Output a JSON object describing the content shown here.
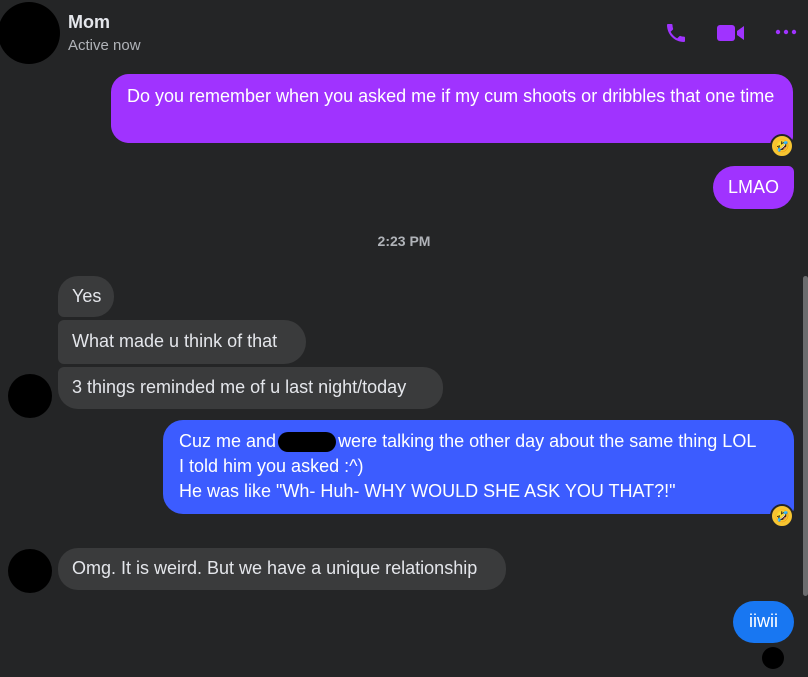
{
  "header": {
    "name": "Mom",
    "status": "Active now",
    "accent": "#a033ff"
  },
  "icons": {
    "call": "phone-icon",
    "video": "video-camera-icon",
    "more": "more-options-icon",
    "reaction": "rolling-laughing-emoji"
  },
  "messages": {
    "m1": "Do you remember when you asked me if my cum shoots or dribbles that one time",
    "m2": "LMAO",
    "timestamp": "2:23 PM",
    "m3": "Yes",
    "m4": "What made u think of that",
    "m5": "3 things reminded me of u last night/today",
    "m6_line1_a": "Cuz me and",
    "m6_line1_b": "were talking the other day about the same thing LOL",
    "m6_line2": "I told him you asked :^)",
    "m6_line3": "He was like \"Wh- Huh- WHY WOULD SHE ASK YOU THAT?!\"",
    "m7": "Omg. It is weird. But we have a unique relationship",
    "m8": "iiwii"
  },
  "reactions": {
    "emoji": "🤣"
  }
}
